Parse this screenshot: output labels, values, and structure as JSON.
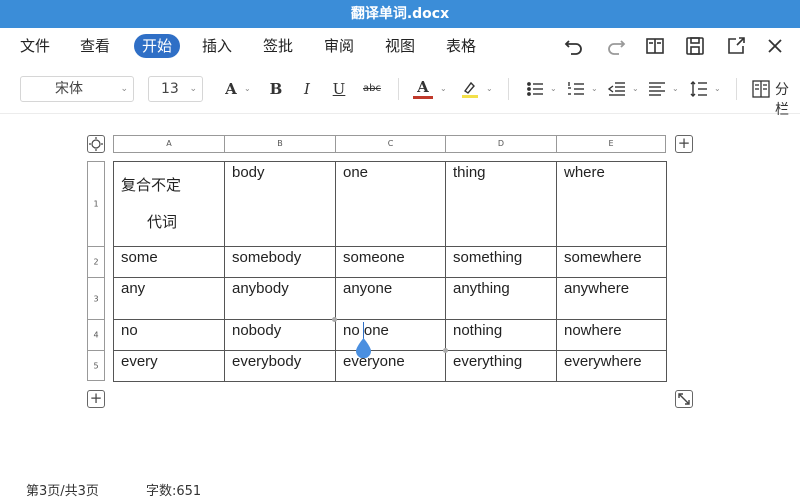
{
  "window": {
    "title": "翻译单词.docx"
  },
  "menu": {
    "items": [
      "文件",
      "查看",
      "开始",
      "插入",
      "签批",
      "审阅",
      "视图",
      "表格"
    ],
    "active_index": 2
  },
  "toolbar": {
    "font_name": "宋体",
    "font_size": "13",
    "font_color_label": "A",
    "bold": "B",
    "italic": "I",
    "underline": "U",
    "strikethrough": "abc",
    "font_color": "A",
    "columns_label": "分栏",
    "colors": {
      "font_color_bar": "#c0392b",
      "highlight": "#f3e04a",
      "accent": "#2f6fc6"
    }
  },
  "table": {
    "col_headers": [
      "A",
      "B",
      "C",
      "D",
      "E"
    ],
    "row_headers": [
      "1",
      "2",
      "3",
      "4",
      "5"
    ],
    "header_cell": {
      "line1": "复合不定",
      "line2": "代词"
    },
    "rows": [
      [
        "",
        "body",
        "one",
        "thing",
        "where"
      ],
      [
        "some",
        "somebody",
        "someone",
        "something",
        "somewhere"
      ],
      [
        "any",
        "anybody",
        "anyone",
        "anything",
        "anywhere"
      ],
      [
        "no",
        "nobody",
        "no one",
        "nothing",
        "nowhere"
      ],
      [
        "every",
        "everybody",
        "everyone",
        "everything",
        "everywhere"
      ]
    ]
  },
  "status": {
    "page": "第3页/共3页",
    "word_count": "字数:651"
  }
}
